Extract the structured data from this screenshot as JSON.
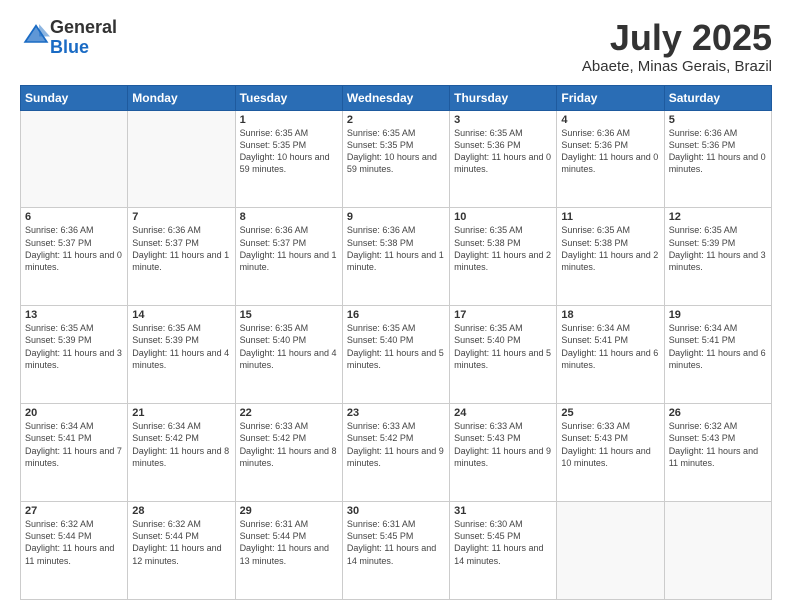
{
  "header": {
    "logo_general": "General",
    "logo_blue": "Blue",
    "title": "July 2025",
    "location": "Abaete, Minas Gerais, Brazil"
  },
  "calendar": {
    "days_of_week": [
      "Sunday",
      "Monday",
      "Tuesday",
      "Wednesday",
      "Thursday",
      "Friday",
      "Saturday"
    ],
    "weeks": [
      [
        {
          "day": "",
          "info": ""
        },
        {
          "day": "",
          "info": ""
        },
        {
          "day": "1",
          "info": "Sunrise: 6:35 AM\nSunset: 5:35 PM\nDaylight: 10 hours and 59 minutes."
        },
        {
          "day": "2",
          "info": "Sunrise: 6:35 AM\nSunset: 5:35 PM\nDaylight: 10 hours and 59 minutes."
        },
        {
          "day": "3",
          "info": "Sunrise: 6:35 AM\nSunset: 5:36 PM\nDaylight: 11 hours and 0 minutes."
        },
        {
          "day": "4",
          "info": "Sunrise: 6:36 AM\nSunset: 5:36 PM\nDaylight: 11 hours and 0 minutes."
        },
        {
          "day": "5",
          "info": "Sunrise: 6:36 AM\nSunset: 5:36 PM\nDaylight: 11 hours and 0 minutes."
        }
      ],
      [
        {
          "day": "6",
          "info": "Sunrise: 6:36 AM\nSunset: 5:37 PM\nDaylight: 11 hours and 0 minutes."
        },
        {
          "day": "7",
          "info": "Sunrise: 6:36 AM\nSunset: 5:37 PM\nDaylight: 11 hours and 1 minute."
        },
        {
          "day": "8",
          "info": "Sunrise: 6:36 AM\nSunset: 5:37 PM\nDaylight: 11 hours and 1 minute."
        },
        {
          "day": "9",
          "info": "Sunrise: 6:36 AM\nSunset: 5:38 PM\nDaylight: 11 hours and 1 minute."
        },
        {
          "day": "10",
          "info": "Sunrise: 6:35 AM\nSunset: 5:38 PM\nDaylight: 11 hours and 2 minutes."
        },
        {
          "day": "11",
          "info": "Sunrise: 6:35 AM\nSunset: 5:38 PM\nDaylight: 11 hours and 2 minutes."
        },
        {
          "day": "12",
          "info": "Sunrise: 6:35 AM\nSunset: 5:39 PM\nDaylight: 11 hours and 3 minutes."
        }
      ],
      [
        {
          "day": "13",
          "info": "Sunrise: 6:35 AM\nSunset: 5:39 PM\nDaylight: 11 hours and 3 minutes."
        },
        {
          "day": "14",
          "info": "Sunrise: 6:35 AM\nSunset: 5:39 PM\nDaylight: 11 hours and 4 minutes."
        },
        {
          "day": "15",
          "info": "Sunrise: 6:35 AM\nSunset: 5:40 PM\nDaylight: 11 hours and 4 minutes."
        },
        {
          "day": "16",
          "info": "Sunrise: 6:35 AM\nSunset: 5:40 PM\nDaylight: 11 hours and 5 minutes."
        },
        {
          "day": "17",
          "info": "Sunrise: 6:35 AM\nSunset: 5:40 PM\nDaylight: 11 hours and 5 minutes."
        },
        {
          "day": "18",
          "info": "Sunrise: 6:34 AM\nSunset: 5:41 PM\nDaylight: 11 hours and 6 minutes."
        },
        {
          "day": "19",
          "info": "Sunrise: 6:34 AM\nSunset: 5:41 PM\nDaylight: 11 hours and 6 minutes."
        }
      ],
      [
        {
          "day": "20",
          "info": "Sunrise: 6:34 AM\nSunset: 5:41 PM\nDaylight: 11 hours and 7 minutes."
        },
        {
          "day": "21",
          "info": "Sunrise: 6:34 AM\nSunset: 5:42 PM\nDaylight: 11 hours and 8 minutes."
        },
        {
          "day": "22",
          "info": "Sunrise: 6:33 AM\nSunset: 5:42 PM\nDaylight: 11 hours and 8 minutes."
        },
        {
          "day": "23",
          "info": "Sunrise: 6:33 AM\nSunset: 5:42 PM\nDaylight: 11 hours and 9 minutes."
        },
        {
          "day": "24",
          "info": "Sunrise: 6:33 AM\nSunset: 5:43 PM\nDaylight: 11 hours and 9 minutes."
        },
        {
          "day": "25",
          "info": "Sunrise: 6:33 AM\nSunset: 5:43 PM\nDaylight: 11 hours and 10 minutes."
        },
        {
          "day": "26",
          "info": "Sunrise: 6:32 AM\nSunset: 5:43 PM\nDaylight: 11 hours and 11 minutes."
        }
      ],
      [
        {
          "day": "27",
          "info": "Sunrise: 6:32 AM\nSunset: 5:44 PM\nDaylight: 11 hours and 11 minutes."
        },
        {
          "day": "28",
          "info": "Sunrise: 6:32 AM\nSunset: 5:44 PM\nDaylight: 11 hours and 12 minutes."
        },
        {
          "day": "29",
          "info": "Sunrise: 6:31 AM\nSunset: 5:44 PM\nDaylight: 11 hours and 13 minutes."
        },
        {
          "day": "30",
          "info": "Sunrise: 6:31 AM\nSunset: 5:45 PM\nDaylight: 11 hours and 14 minutes."
        },
        {
          "day": "31",
          "info": "Sunrise: 6:30 AM\nSunset: 5:45 PM\nDaylight: 11 hours and 14 minutes."
        },
        {
          "day": "",
          "info": ""
        },
        {
          "day": "",
          "info": ""
        }
      ]
    ]
  }
}
